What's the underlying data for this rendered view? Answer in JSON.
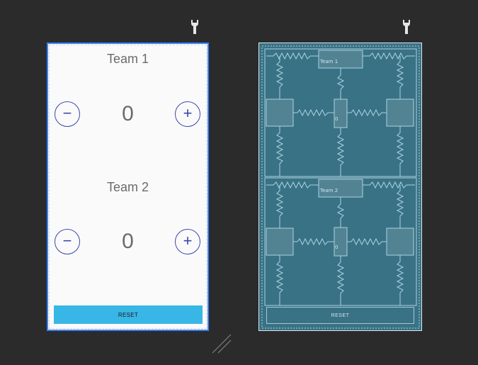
{
  "design": {
    "team1": {
      "label": "Team 1",
      "score": "0",
      "minus": "−",
      "plus": "+"
    },
    "team2": {
      "label": "Team 2",
      "score": "0",
      "minus": "−",
      "plus": "+"
    },
    "reset_label": "RESET"
  },
  "blueprint": {
    "team1_label": "Team 1",
    "team2_label": "Team 2",
    "score1": "0",
    "score2": "0",
    "reset_label": "RESET"
  },
  "colors": {
    "background": "#2b2b2c",
    "accent_button": "#38b6e6",
    "circle_button": "#3949ab",
    "blueprint_bg": "#3a7285"
  },
  "icons": {
    "wrench": "wrench-icon",
    "resize": "resize-handle-icon"
  }
}
